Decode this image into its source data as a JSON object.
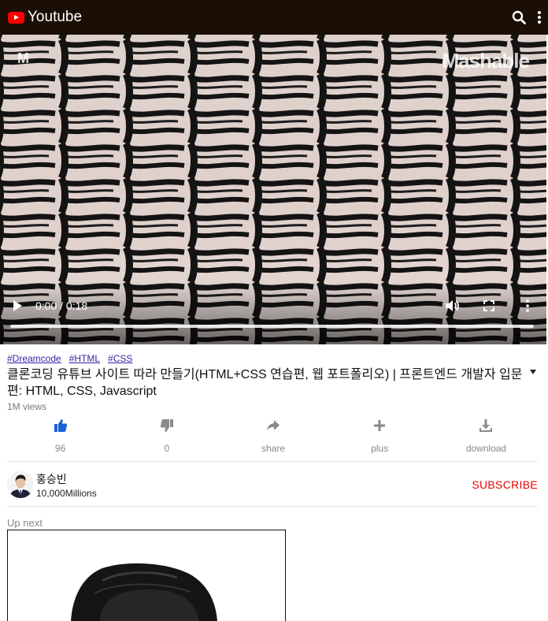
{
  "header": {
    "app_title": "Youtube",
    "search_icon": "search-icon",
    "more_icon": "more-vertical-icon"
  },
  "video": {
    "watermark_left": "M",
    "watermark_right": "Mashable",
    "time_display": "0:00 / 0:18",
    "progress": 0,
    "icons": {
      "play": "play-icon",
      "volume": "volume-icon",
      "fullscreen": "fullscreen-icon",
      "more": "more-vertical-icon"
    }
  },
  "info": {
    "hashtags": [
      "#Dreamcode",
      "#HTML",
      "#CSS"
    ],
    "title": "클론코딩 유튜브 사이트 따라 만들기(HTML+CSS 연습편, 웹 포트폴리오) | 프론트엔드 개발자 입문편: HTML, CSS, Javascript",
    "views": "1M views"
  },
  "actions": [
    {
      "name": "like",
      "label": "96",
      "icon": "thumbs-up-icon",
      "active": true
    },
    {
      "name": "dislike",
      "label": "0",
      "icon": "thumbs-down-icon",
      "active": false
    },
    {
      "name": "share",
      "label": "share",
      "icon": "share-icon",
      "active": false
    },
    {
      "name": "plus",
      "label": "plus",
      "icon": "plus-icon",
      "active": false
    },
    {
      "name": "download",
      "label": "download",
      "icon": "download-icon",
      "active": false
    }
  ],
  "channel": {
    "name": "홍승빈",
    "subscribers": "10,000Millions",
    "subscribe_label": "SUBSCRIBE"
  },
  "up_next": {
    "label": "Up next"
  },
  "colors": {
    "header_bg": "#1b0e05",
    "brand_red": "#ff0000",
    "like_active": "#1a5fd6",
    "action_gray": "#8a8a8a",
    "subscribe_red": "#e60000",
    "hashtag": "#3a23a8"
  }
}
